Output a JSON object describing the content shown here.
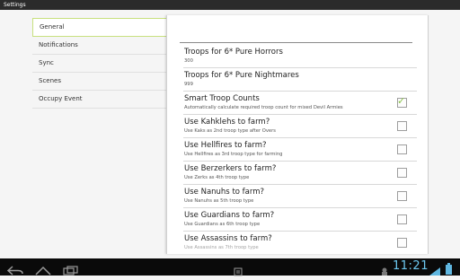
{
  "window": {
    "title": "Settings"
  },
  "sidebar": {
    "items": [
      {
        "label": "General"
      },
      {
        "label": "Notifications"
      },
      {
        "label": "Sync"
      },
      {
        "label": "Scenes"
      },
      {
        "label": "Occupy Event"
      }
    ]
  },
  "preferences": [
    {
      "title": "Troops for 6* Pure Horrors",
      "summary": "300"
    },
    {
      "title": "Troops for 6* Pure Nightmares",
      "summary": "999"
    },
    {
      "title": "Smart Troop Counts",
      "summary": "Automatically calculate required troop count for mixed Devil Armies",
      "checked": true
    },
    {
      "title": "Use Kahklehs to farm?",
      "summary": "Use Kaks as 2nd troop type after Overs",
      "checked": false
    },
    {
      "title": "Use Hellfires to farm?",
      "summary": "Use Hellfires as 3rd troop type for farming",
      "checked": false
    },
    {
      "title": "Use Berzerkers to farm?",
      "summary": "Use Zerks as 4th troop type",
      "checked": false
    },
    {
      "title": "Use Nanuhs to farm?",
      "summary": "Use Nanuhs as 5th troop type",
      "checked": false
    },
    {
      "title": "Use Guardians to farm?",
      "summary": "Use Guardians as 6th troop type",
      "checked": false
    },
    {
      "title": "Use Assassins to farm?",
      "summary": "Use Assassins as 7th troop type",
      "checked": false
    }
  ],
  "status_bar": {
    "time": "11:21"
  },
  "colors": {
    "accent": "#8bc34a",
    "clock": "#6cc8f0",
    "titlebar": "#2b2b2b"
  }
}
